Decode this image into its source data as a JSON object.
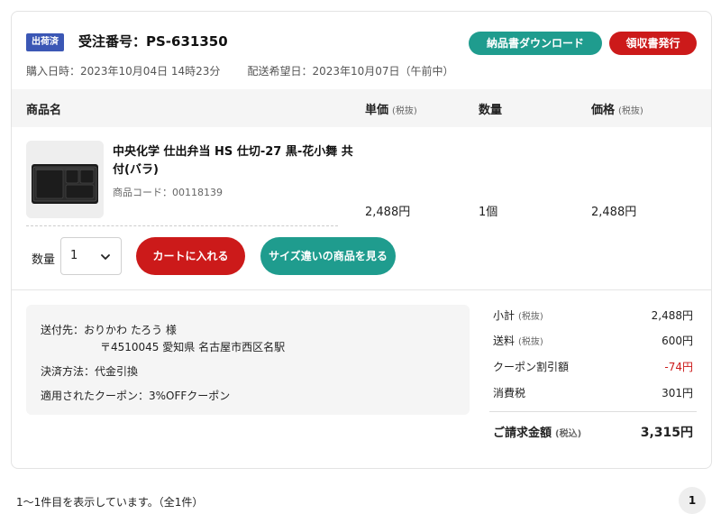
{
  "order": {
    "status_badge": "出荷済",
    "number": "受注番号：PS-631350",
    "purchase_date": "購入日時：2023年10月04日 14時23分",
    "delivery_date": "配送希望日：2023年10月07日（午前中）",
    "download_label": "納品書ダウンロード",
    "receipt_label": "領収書発行"
  },
  "table": {
    "col_name": "商品名",
    "col_unit_price": "単価",
    "col_qty": "数量",
    "col_price": "価格",
    "tax_excl": "(税抜)"
  },
  "item": {
    "name": "中央化学 仕出弁当 HS 仕切-27 黒-花小舞 共付(バラ)",
    "code": "商品コード：00118139",
    "unit_price": "2,488円",
    "qty": "1個",
    "price": "2,488円",
    "image_icon": "bento-box-image"
  },
  "actions": {
    "qty_label": "数量",
    "qty_value": "1",
    "cart_label": "カートに入れる",
    "size_label": "サイズ違いの商品を見る"
  },
  "shipping": {
    "recipient": "送付先：おりかわ たろう 様",
    "address": "〒4510045 愛知県 名古屋市西区名駅",
    "payment": "決済方法：代金引換",
    "coupon": "適用されたクーポン：3%OFFクーポン"
  },
  "summary": {
    "subtotal_label": "小計",
    "subtotal": "2,488円",
    "shipping_label": "送料",
    "shipping": "600円",
    "coupon_label": "クーポン割引額",
    "coupon": "-74円",
    "tax_label": "消費税",
    "tax": "301円",
    "total_label": "ご請求金額",
    "tax_incl": "(税込)",
    "total": "3,315円"
  },
  "pagination": {
    "info": "1～1件目を表示しています。（全1件）",
    "page": "1"
  },
  "colors": {
    "teal": "#1f9c8e",
    "red": "#cc1a1a",
    "badge_blue": "#3b57b5"
  }
}
